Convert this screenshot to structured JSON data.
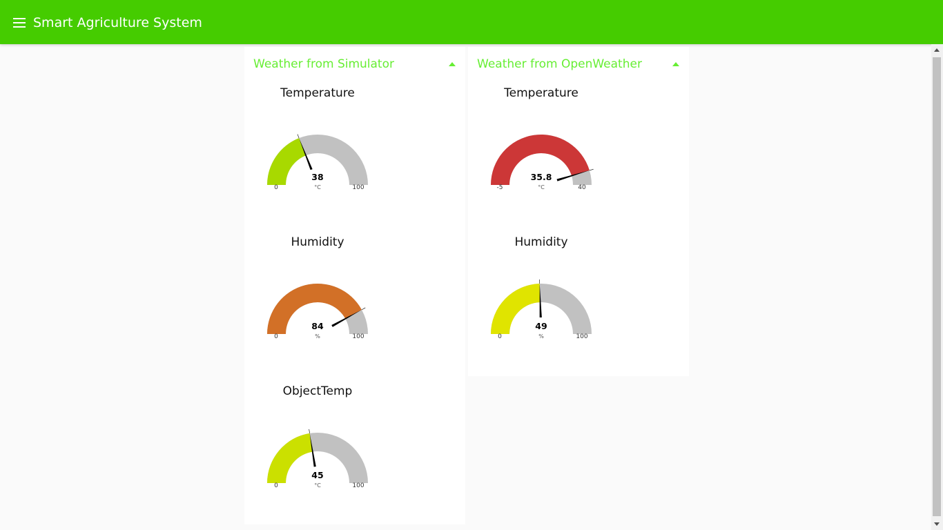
{
  "app": {
    "title": "Smart Agriculture System",
    "accent_color": "#45cc00",
    "group_title_color": "#66ee33",
    "menu_icon": "hamburger-menu-icon"
  },
  "groups": [
    {
      "title": "Weather from Simulator",
      "collapse_icon": "caret-up-icon",
      "gauges": [
        {
          "label": "Temperature",
          "value": 38,
          "value_text": "38",
          "unit": "°C",
          "min": 0,
          "max": 100,
          "min_text": "0",
          "max_text": "100",
          "color": "#a8d900"
        },
        {
          "label": "Humidity",
          "value": 84,
          "value_text": "84",
          "unit": "%",
          "min": 0,
          "max": 100,
          "min_text": "0",
          "max_text": "100",
          "color": "#d27027"
        },
        {
          "label": "ObjectTemp",
          "value": 45,
          "value_text": "45",
          "unit": "°C",
          "min": 0,
          "max": 100,
          "min_text": "0",
          "max_text": "100",
          "color": "#cbe000"
        }
      ]
    },
    {
      "title": "Weather from OpenWeather",
      "collapse_icon": "caret-up-icon",
      "gauges": [
        {
          "label": "Temperature",
          "value": 35.8,
          "value_text": "35.8",
          "unit": "°C",
          "min": -5,
          "max": 40,
          "min_text": "-5",
          "max_text": "40",
          "color": "#cc3737"
        },
        {
          "label": "Humidity",
          "value": 49,
          "value_text": "49",
          "unit": "%",
          "min": 0,
          "max": 100,
          "min_text": "0",
          "max_text": "100",
          "color": "#e0e400"
        }
      ]
    }
  ]
}
